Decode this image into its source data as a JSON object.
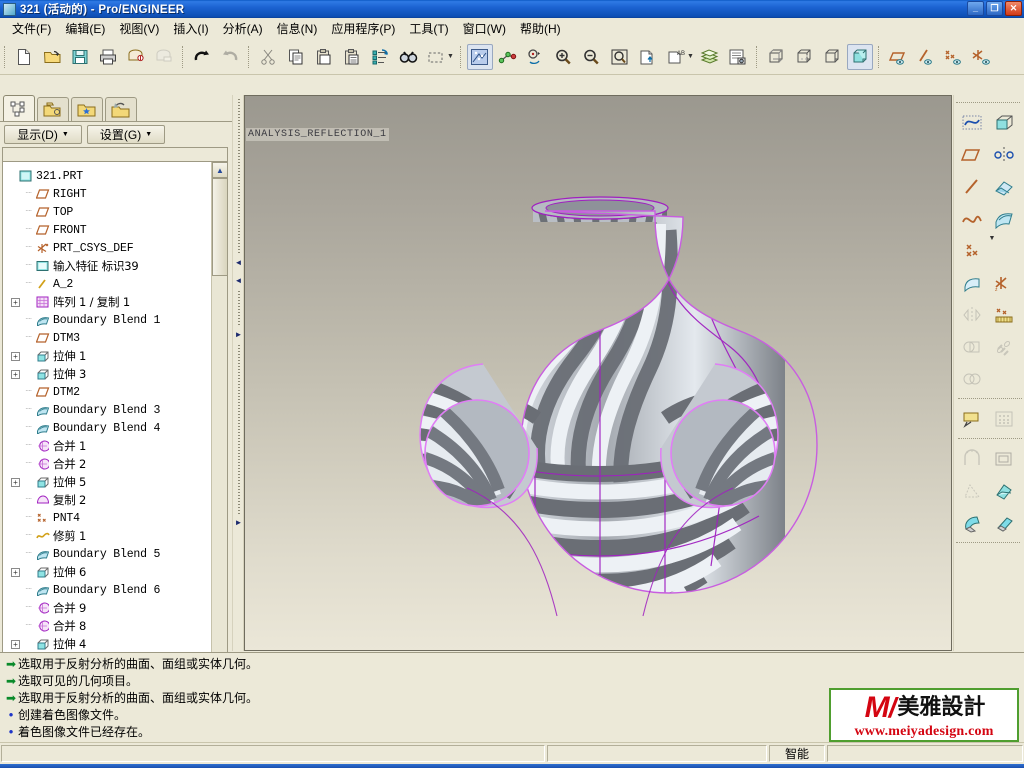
{
  "window": {
    "title": "321 (活动的) - Pro/ENGINEER",
    "icon": "part-icon",
    "buttons": [
      {
        "name": "minimize-button",
        "glyph": "_"
      },
      {
        "name": "restore-button",
        "glyph": "❐"
      },
      {
        "name": "close-button",
        "glyph": "✕"
      }
    ]
  },
  "menubar": {
    "items": [
      {
        "name": "menu-file",
        "label": "文件(F)"
      },
      {
        "name": "menu-edit",
        "label": "编辑(E)"
      },
      {
        "name": "menu-view",
        "label": "视图(V)"
      },
      {
        "name": "menu-insert",
        "label": "插入(I)"
      },
      {
        "name": "menu-analysis",
        "label": "分析(A)"
      },
      {
        "name": "menu-info",
        "label": "信息(N)"
      },
      {
        "name": "menu-applications",
        "label": "应用程序(P)"
      },
      {
        "name": "menu-tools",
        "label": "工具(T)"
      },
      {
        "name": "menu-window",
        "label": "窗口(W)"
      },
      {
        "name": "menu-help",
        "label": "帮助(H)"
      }
    ]
  },
  "toolbar": {
    "groups": [
      [
        "new-file-icon",
        "open-file-icon",
        "save-icon",
        "print-icon",
        "mail-icon",
        "mail-disabled-icon"
      ],
      [
        "undo-icon",
        "redo-icon"
      ],
      [
        "cut-icon",
        "copy-icon",
        "paste-icon",
        "paste-special-icon",
        "regenerate-icon",
        "find-icon",
        "select-box-icon"
      ],
      [
        "reflection-analysis-icon",
        "datum-display-icon",
        "spin-center-icon",
        "zoom-in-icon",
        "zoom-out-icon",
        "refit-icon",
        "repaint-icon",
        "layer-tag-icon",
        "layers-icon",
        "view-manager-icon"
      ],
      [
        "wireframe-icon",
        "hidden-line-icon",
        "no-hidden-icon",
        "shaded-icon"
      ],
      [
        "datum-plane-display-icon",
        "datum-axis-display-icon",
        "datum-point-display-icon",
        "datum-csys-display-icon"
      ]
    ]
  },
  "left_panel": {
    "tabs": [
      {
        "name": "tab-model-tree",
        "icon": "model-tree-icon",
        "selected": true
      },
      {
        "name": "tab-folder-browser",
        "icon": "folder-browser-icon",
        "selected": false
      },
      {
        "name": "tab-favorites",
        "icon": "favorites-folder-icon",
        "selected": false
      },
      {
        "name": "tab-connections",
        "icon": "connections-icon",
        "selected": false
      }
    ],
    "buttons": [
      {
        "name": "show-menu-button",
        "label": "显示(D)"
      },
      {
        "name": "settings-menu-button",
        "label": "设置(G)"
      }
    ],
    "tree": [
      {
        "label": "321.PRT",
        "icon": "part-icon",
        "indent": 0,
        "expander": "none",
        "dash": false
      },
      {
        "label": "RIGHT",
        "icon": "datum-plane-icon",
        "indent": 1,
        "expander": "none",
        "dash": true
      },
      {
        "label": "TOP",
        "icon": "datum-plane-icon",
        "indent": 1,
        "expander": "none",
        "dash": true
      },
      {
        "label": "FRONT",
        "icon": "datum-plane-icon",
        "indent": 1,
        "expander": "none",
        "dash": true
      },
      {
        "label": "PRT_CSYS_DEF",
        "icon": "csys-icon",
        "indent": 1,
        "expander": "none",
        "dash": true
      },
      {
        "label": "输入特征 标识39",
        "icon": "import-feature-icon",
        "indent": 1,
        "expander": "none",
        "dash": true
      },
      {
        "label": "A_2",
        "icon": "axis-icon",
        "indent": 1,
        "expander": "none",
        "dash": true
      },
      {
        "label": "阵列 1 / 复制 1",
        "icon": "pattern-icon",
        "indent": 1,
        "expander": "plus",
        "dash": false
      },
      {
        "label": "Boundary Blend 1",
        "icon": "boundary-blend-icon",
        "indent": 1,
        "expander": "none",
        "dash": true
      },
      {
        "label": "DTM3",
        "icon": "datum-plane-icon",
        "indent": 1,
        "expander": "none",
        "dash": true
      },
      {
        "label": "拉伸 1",
        "icon": "extrude-icon",
        "indent": 1,
        "expander": "plus",
        "dash": false
      },
      {
        "label": "拉伸 3",
        "icon": "extrude-icon",
        "indent": 1,
        "expander": "plus",
        "dash": false
      },
      {
        "label": "DTM2",
        "icon": "datum-plane-icon",
        "indent": 1,
        "expander": "none",
        "dash": true
      },
      {
        "label": "Boundary Blend 3",
        "icon": "boundary-blend-icon",
        "indent": 1,
        "expander": "none",
        "dash": true
      },
      {
        "label": "Boundary Blend 4",
        "icon": "boundary-blend-icon",
        "indent": 1,
        "expander": "none",
        "dash": true
      },
      {
        "label": "合并 1",
        "icon": "merge-icon",
        "indent": 1,
        "expander": "none",
        "dash": true
      },
      {
        "label": "合并 2",
        "icon": "merge-icon",
        "indent": 1,
        "expander": "none",
        "dash": true
      },
      {
        "label": "拉伸 5",
        "icon": "extrude-icon",
        "indent": 1,
        "expander": "plus",
        "dash": false
      },
      {
        "label": "复制 2",
        "icon": "copy-feature-icon",
        "indent": 1,
        "expander": "none",
        "dash": true
      },
      {
        "label": "PNT4",
        "icon": "point-icon",
        "indent": 1,
        "expander": "none",
        "dash": true
      },
      {
        "label": "修剪 1",
        "icon": "trim-icon",
        "indent": 1,
        "expander": "none",
        "dash": true
      },
      {
        "label": "Boundary Blend 5",
        "icon": "boundary-blend-icon",
        "indent": 1,
        "expander": "none",
        "dash": true
      },
      {
        "label": "拉伸 6",
        "icon": "extrude-icon",
        "indent": 1,
        "expander": "plus",
        "dash": false
      },
      {
        "label": "Boundary Blend 6",
        "icon": "boundary-blend-icon",
        "indent": 1,
        "expander": "none",
        "dash": true
      },
      {
        "label": "合并 9",
        "icon": "merge-icon",
        "indent": 1,
        "expander": "none",
        "dash": true
      },
      {
        "label": "合并 8",
        "icon": "merge-icon",
        "indent": 1,
        "expander": "none",
        "dash": true
      },
      {
        "label": "拉伸 4",
        "icon": "extrude-icon",
        "indent": 1,
        "expander": "plus",
        "dash": false
      }
    ]
  },
  "viewport": {
    "label": "ANALYSIS_REFLECTION_1",
    "background_top": "#9b988f",
    "background_bottom": "#ebe7d8",
    "model_edge_color": "#a020c0",
    "stripe_dark": "#6e7178",
    "stripe_light": "#e9edf2"
  },
  "right_toolbar": {
    "items": [
      "sketch-icon",
      "extrude-icon",
      "datum-plane-icon",
      "datum-axis-mirror-icon",
      "datum-axis-icon",
      "sweep-icon",
      "datum-curve-icon",
      "boundary-blend-icon",
      "datum-point-icon",
      "style-icon",
      "datum-csys-icon",
      "mirror-disabled-icon",
      "cosmetic-sketch-icon",
      "merge-disabled-icon",
      "ref-chain-disabled-icon",
      "intersect-disabled-icon",
      "annotation-icon",
      "fill-pattern-disabled-icon",
      "round-disabled-icon",
      "shell-icon",
      "draft-disabled-icon",
      "solidify-icon",
      "sweep-blend-icon",
      "offset-icon"
    ]
  },
  "messages": [
    {
      "type": "arrow",
      "text": "选取用于反射分析的曲面、面组或实体几何。"
    },
    {
      "type": "arrow",
      "text": "选取可见的几何项目。"
    },
    {
      "type": "arrow",
      "text": "选取用于反射分析的曲面、面组或实体几何。"
    },
    {
      "type": "dot",
      "text": "创建着色图像文件。"
    },
    {
      "type": "dot",
      "text": "着色图像文件已经存在。"
    }
  ],
  "statusbar": {
    "left_text": "",
    "middle_text": "",
    "smart_selector": "智能"
  },
  "watermark": {
    "logo_letter": "M",
    "slash": "/",
    "brand_cjk": "美雅設計",
    "url": "www.meiyadesign.com",
    "border_color": "#4f9e2f",
    "red": "#d40511"
  }
}
